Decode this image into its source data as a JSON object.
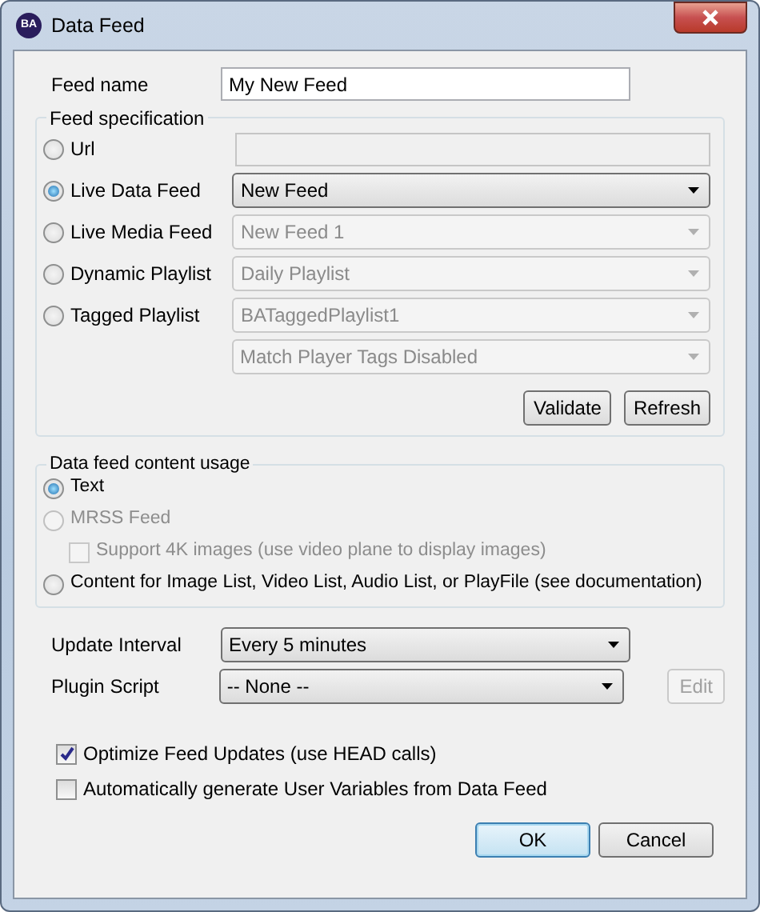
{
  "window": {
    "title": "Data Feed",
    "icon_text": "BA"
  },
  "feed_name": {
    "label": "Feed name",
    "value": "My New Feed"
  },
  "feed_specification": {
    "title": "Feed specification",
    "options": [
      {
        "label": "Url",
        "selected": false,
        "field": {
          "kind": "text",
          "disabled": true
        }
      },
      {
        "label": "Live Data Feed",
        "selected": true,
        "field": {
          "kind": "select",
          "value": "New Feed",
          "disabled": false
        }
      },
      {
        "label": "Live Media Feed",
        "selected": false,
        "field": {
          "kind": "select",
          "value": "New Feed 1",
          "disabled": true
        }
      },
      {
        "label": "Dynamic Playlist",
        "selected": false,
        "field": {
          "kind": "select",
          "value": "Daily Playlist",
          "disabled": true
        }
      },
      {
        "label": "Tagged Playlist",
        "selected": false,
        "field": {
          "kind": "select",
          "value": "BATaggedPlaylist1",
          "disabled": true
        }
      }
    ],
    "extra_select": {
      "value": "Match Player Tags Disabled",
      "disabled": true
    },
    "buttons": [
      {
        "label": "Validate"
      },
      {
        "label": "Refresh"
      }
    ]
  },
  "content_usage": {
    "title": "Data feed content usage",
    "options": [
      {
        "label": "Text",
        "selected": true,
        "disabled": false
      },
      {
        "label": "MRSS Feed",
        "selected": false,
        "disabled": true,
        "sub_checkbox": {
          "label": "Support 4K images (use video plane to display images)",
          "checked": false,
          "disabled": true
        }
      },
      {
        "label": "Content for Image List, Video List, Audio List, or PlayFile (see documentation)",
        "selected": false,
        "disabled": false
      }
    ]
  },
  "update_interval": {
    "label": "Update Interval",
    "value": "Every 5 minutes"
  },
  "plugin_script": {
    "label": "Plugin Script",
    "value": "-- None --",
    "edit_button": {
      "label": "Edit",
      "disabled": true
    }
  },
  "checkboxes": [
    {
      "label": "Optimize Feed Updates (use HEAD calls)",
      "checked": true
    },
    {
      "label": "Automatically generate User Variables from Data Feed",
      "checked": false
    }
  ],
  "buttons": [
    {
      "label": "OK",
      "default": true
    },
    {
      "label": "Cancel",
      "default": false
    }
  ]
}
